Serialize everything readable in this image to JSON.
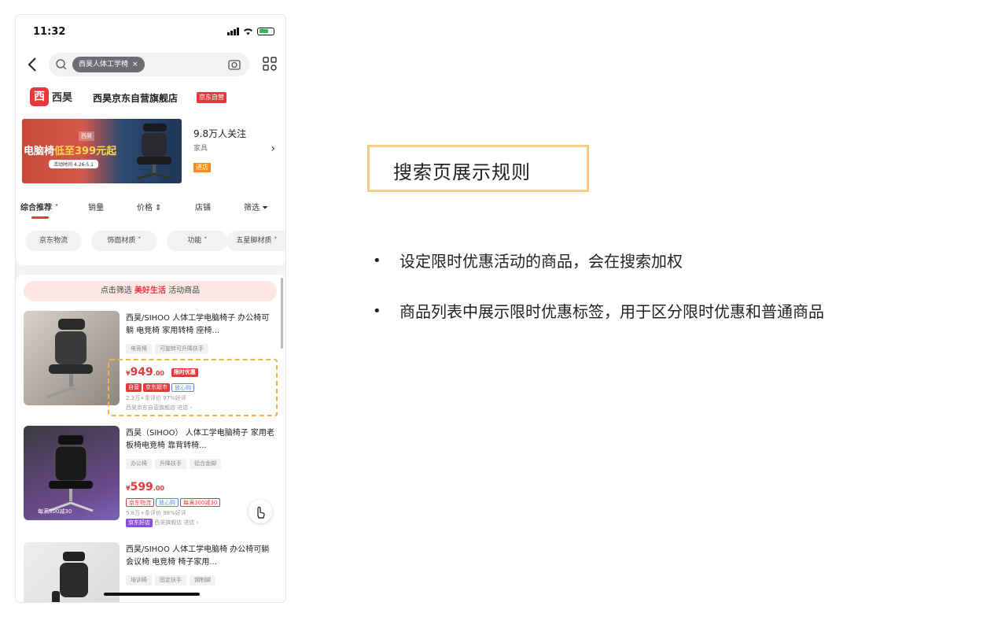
{
  "status": {
    "time": "11:32"
  },
  "search": {
    "chip_text": "西昊人体工学椅",
    "chip_close": "×"
  },
  "shop": {
    "logo_char": "西",
    "logo_text": "西昊",
    "name": "西昊京东自营旗舰店",
    "badge": "京东自营",
    "banner_brand": "西昊",
    "banner_title_a": "电脑椅",
    "banner_title_b": "低至399元起",
    "banner_sub": "活动时间 4.26-5.1",
    "followers": "9.8万人关注",
    "category": "家具",
    "entry_tag": "进店",
    "chevron": "›"
  },
  "sort": {
    "items": [
      "综合推荐 ˅",
      "销量",
      "价格 ⇕",
      "店铺",
      "筛选 ⏷"
    ]
  },
  "filters": [
    "京东物流",
    "饰面材质 ˅",
    "功能 ˅",
    "五星脚材质 ˅"
  ],
  "promo": {
    "prefix": "点击筛选",
    "highlight": "美好生活",
    "suffix": "活动商品"
  },
  "products": [
    {
      "title": "西昊/SIHOO 人体工学电脑椅子 办公椅可躺 电竞椅 家用转椅 座椅...",
      "tags": [
        "电竞椅",
        "可旋转可升降扶手"
      ],
      "price_symbol": "¥",
      "price": "949",
      "price_dec": ".00",
      "promo_badge": "限时优惠",
      "badges": [
        "自营",
        "京东超市",
        "放心购"
      ],
      "meta": "2.3万+条评价  97%好评",
      "shop": "西昊京东自营旗舰店  进店 ›"
    },
    {
      "title": "西昊（SIHOO） 人体工学电脑椅子 家用老板椅电竞椅 靠背转椅...",
      "tags": [
        "办公椅",
        "升降扶手",
        "铝合金脚"
      ],
      "price_symbol": "¥",
      "price": "599",
      "price_dec": ".00",
      "badges": [
        "京东物流",
        "放心购",
        "每满300减30"
      ],
      "meta": "5.8万+条评价  98%好评",
      "shop_badge": "京东好店",
      "shop": "西昊旗舰店  进店 ›",
      "thumb_badge": "每满300减30"
    },
    {
      "title": "西昊/SIHOO 人体工学电脑椅 办公椅可躺 会议椅 电竞椅 椅子家用...",
      "tags": [
        "培训椅",
        "固定扶手",
        "钢制脚"
      ]
    }
  ],
  "slide": {
    "title": "搜索页展示规则",
    "bullets": [
      "设定限时优惠活动的商品，会在搜索加权",
      "商品列表中展示限时优惠标签，用于区分限时优惠和普通商品"
    ]
  },
  "colors": {
    "accent_red": "#e4393c",
    "highlight_border": "#f5cf85",
    "dashed_border": "#f2b24a"
  }
}
